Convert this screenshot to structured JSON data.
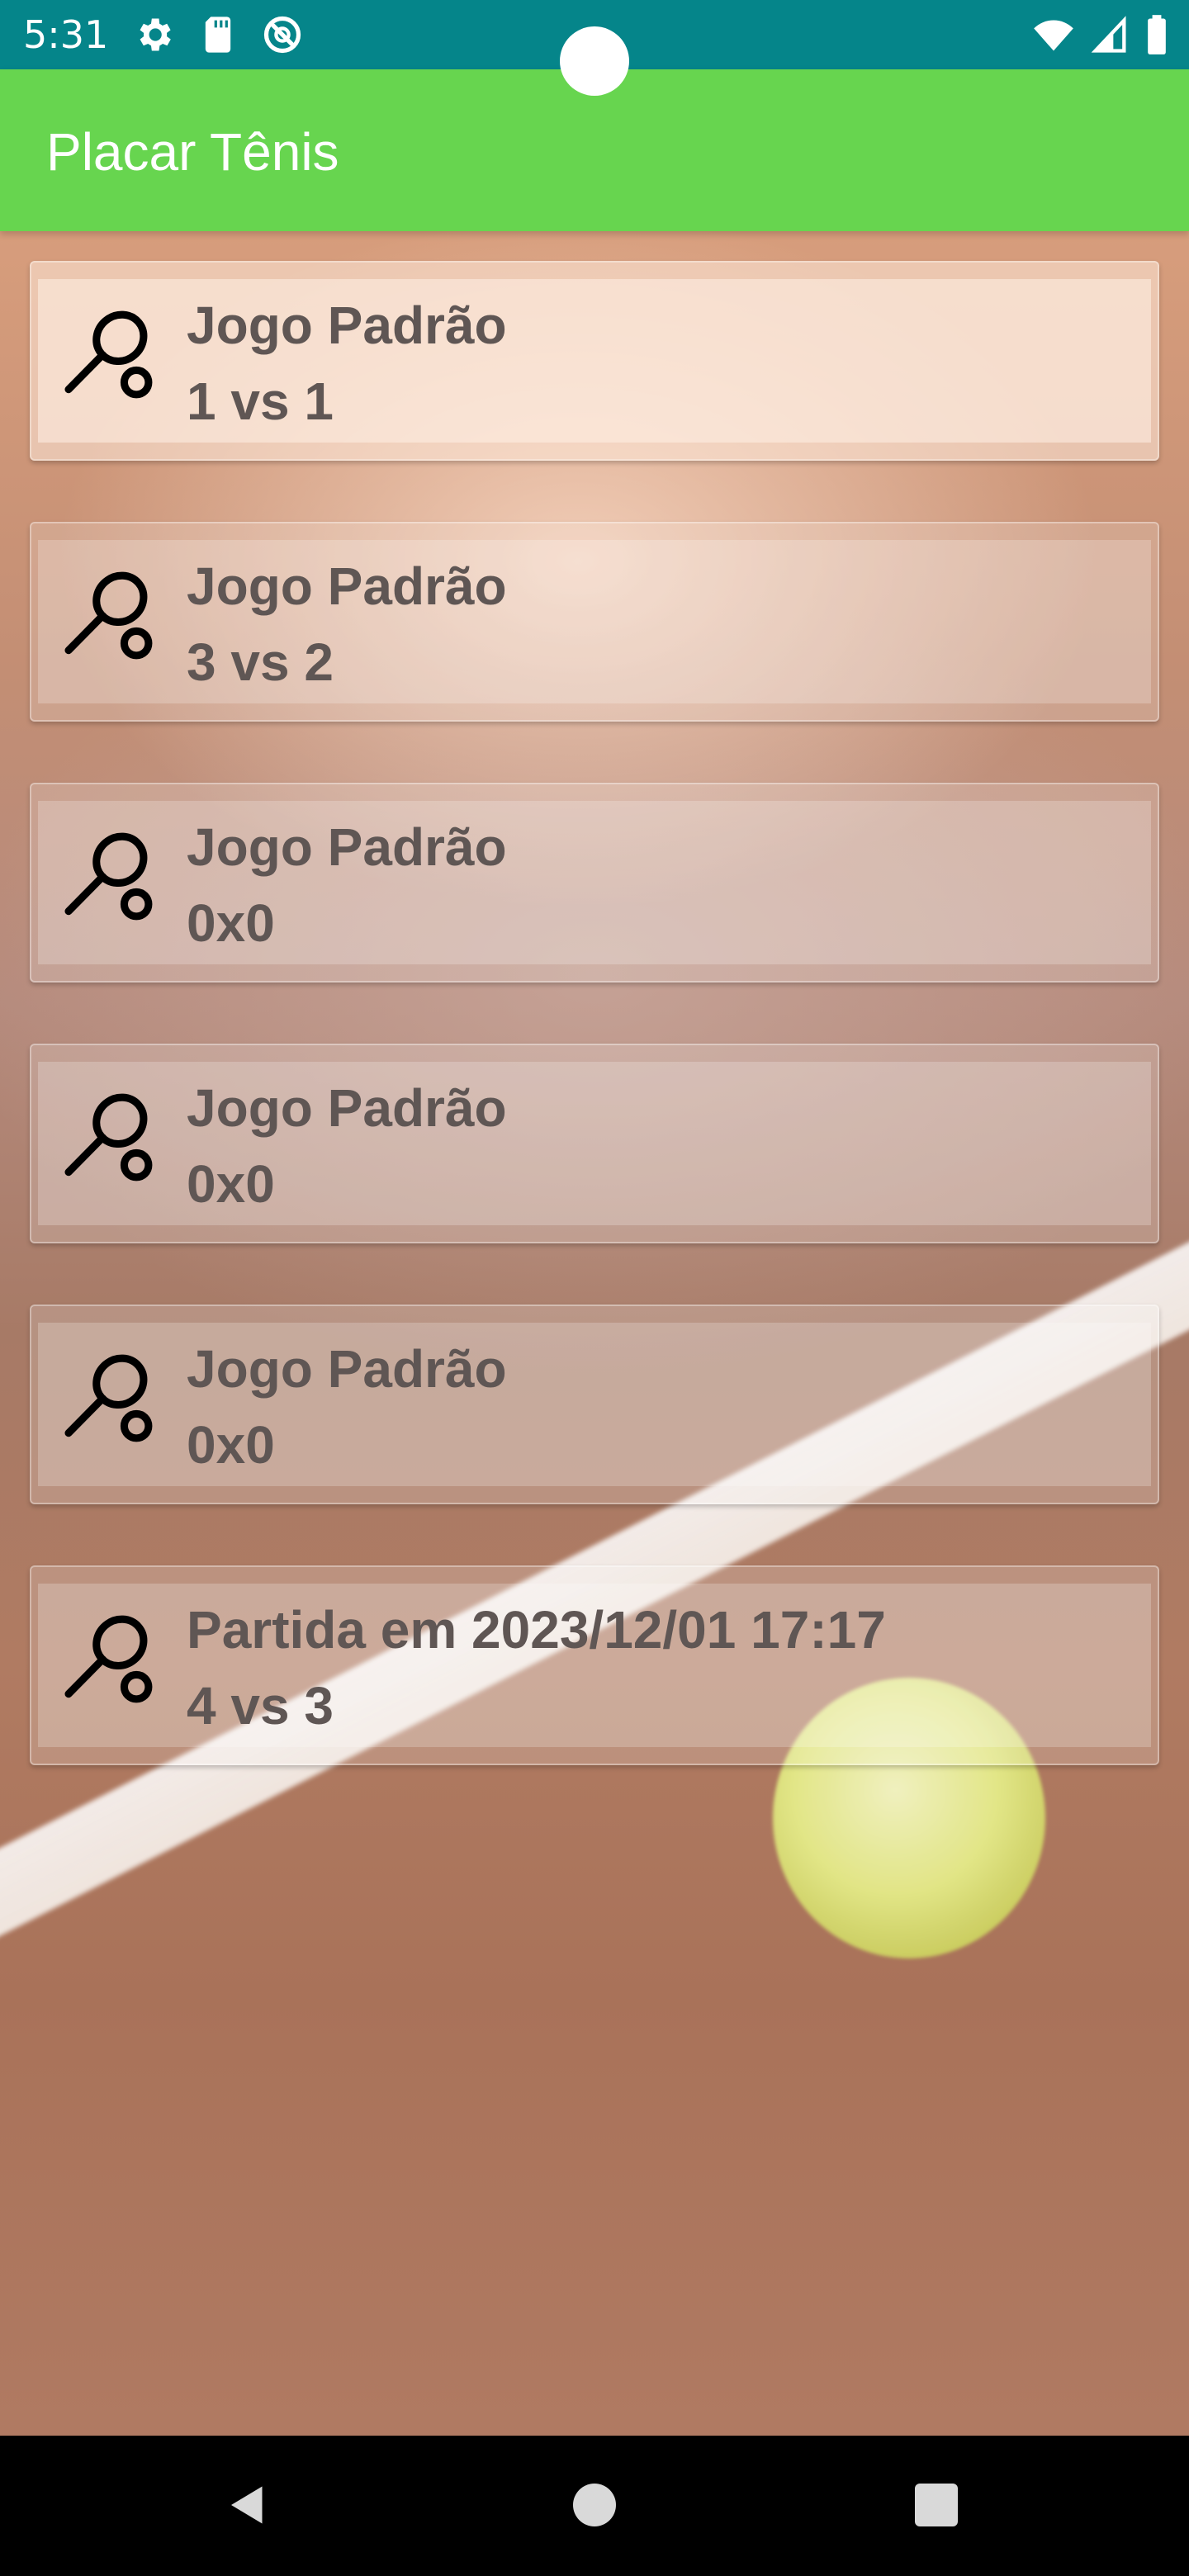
{
  "status_bar": {
    "time": "5:31",
    "icons_left": [
      "settings-icon",
      "sd-card-icon",
      "do-not-disturb-icon"
    ],
    "icons_right": [
      "wifi-icon",
      "signal-icon",
      "battery-icon"
    ]
  },
  "app_bar": {
    "title": "Placar Tênis",
    "color": "#67d54f"
  },
  "matches": [
    {
      "title": "Jogo Padrão",
      "score": "1 vs 1",
      "icon": "tennis-racket-icon"
    },
    {
      "title": "Jogo Padrão",
      "score": "3 vs 2",
      "icon": "tennis-racket-icon"
    },
    {
      "title": "Jogo Padrão",
      "score": "0x0",
      "icon": "tennis-racket-icon"
    },
    {
      "title": "Jogo Padrão",
      "score": "0x0",
      "icon": "tennis-racket-icon"
    },
    {
      "title": "Jogo Padrão",
      "score": "0x0",
      "icon": "tennis-racket-icon"
    },
    {
      "title": "Partida em 2023/12/01 17:17",
      "score": "4 vs 3",
      "icon": "tennis-racket-icon"
    }
  ],
  "nav_bar": {
    "icons": [
      "back-icon",
      "home-icon",
      "recents-icon"
    ]
  },
  "colors": {
    "status_bar": "#05858a",
    "text": "#5f5654"
  }
}
